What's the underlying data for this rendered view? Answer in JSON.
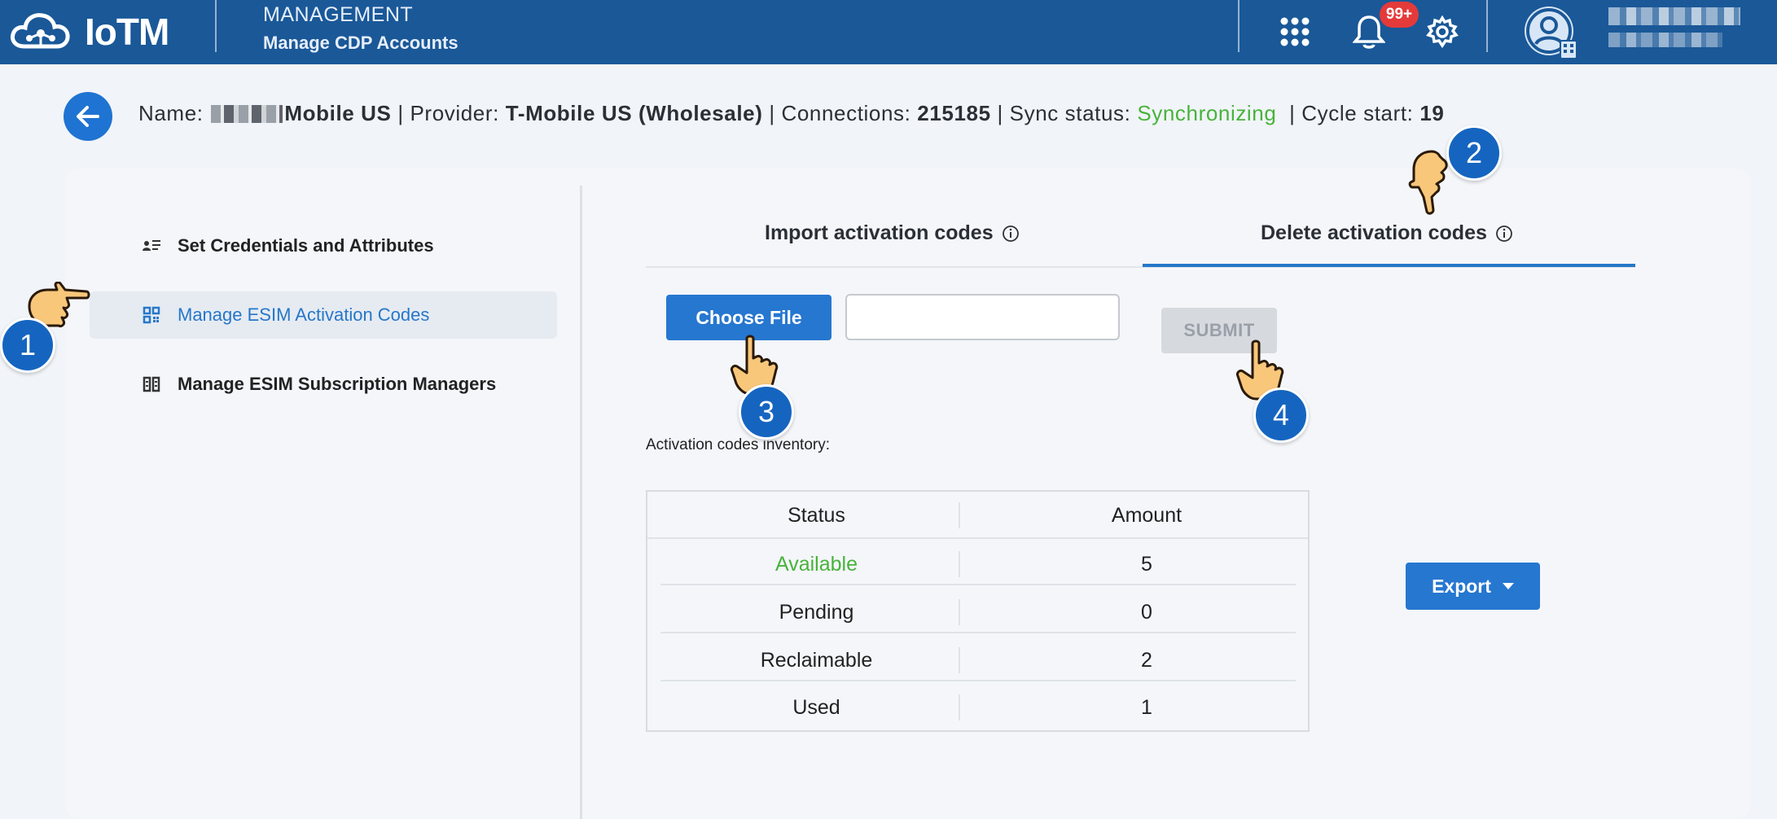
{
  "topbar": {
    "logo_text": "IoTM",
    "section": "MANAGEMENT",
    "subtitle": "Manage CDP Accounts",
    "notification_count": "99+",
    "colors": {
      "bar": "#1a5898",
      "badge": "#e53a3a"
    }
  },
  "header": {
    "name_label": "Name:",
    "name_value": "Mobile US",
    "provider_label": "| Provider:",
    "provider_value": "T-Mobile US (Wholesale)",
    "connections_label": "| Connections:",
    "connections_value": "215185",
    "sync_label": "| Sync status:",
    "sync_value": "Synchronizing",
    "cycle_label": "| Cycle start:",
    "cycle_value": "19"
  },
  "sidebar": {
    "items": [
      {
        "label": "Set Credentials and Attributes",
        "icon": "credentials-icon"
      },
      {
        "label": "Manage ESIM Activation Codes",
        "icon": "qr-code-icon",
        "active": true
      },
      {
        "label": "Manage ESIM Subscription Managers",
        "icon": "book-icon"
      }
    ]
  },
  "tabs": [
    {
      "label": "Import activation codes"
    },
    {
      "label": "Delete activation codes",
      "active": true
    }
  ],
  "upload": {
    "choose_label": "Choose File",
    "file_value": "",
    "submit_label": "SUBMIT"
  },
  "inventory": {
    "label": "Activation codes inventory:",
    "columns": [
      "Status",
      "Amount"
    ],
    "rows": [
      {
        "status": "Available",
        "amount": "5"
      },
      {
        "status": "Pending",
        "amount": "0"
      },
      {
        "status": "Reclaimable",
        "amount": "2"
      },
      {
        "status": "Used",
        "amount": "1"
      }
    ],
    "available_color": "#48b33b"
  },
  "export_label": "Export",
  "steps": [
    "1",
    "2",
    "3",
    "4"
  ]
}
